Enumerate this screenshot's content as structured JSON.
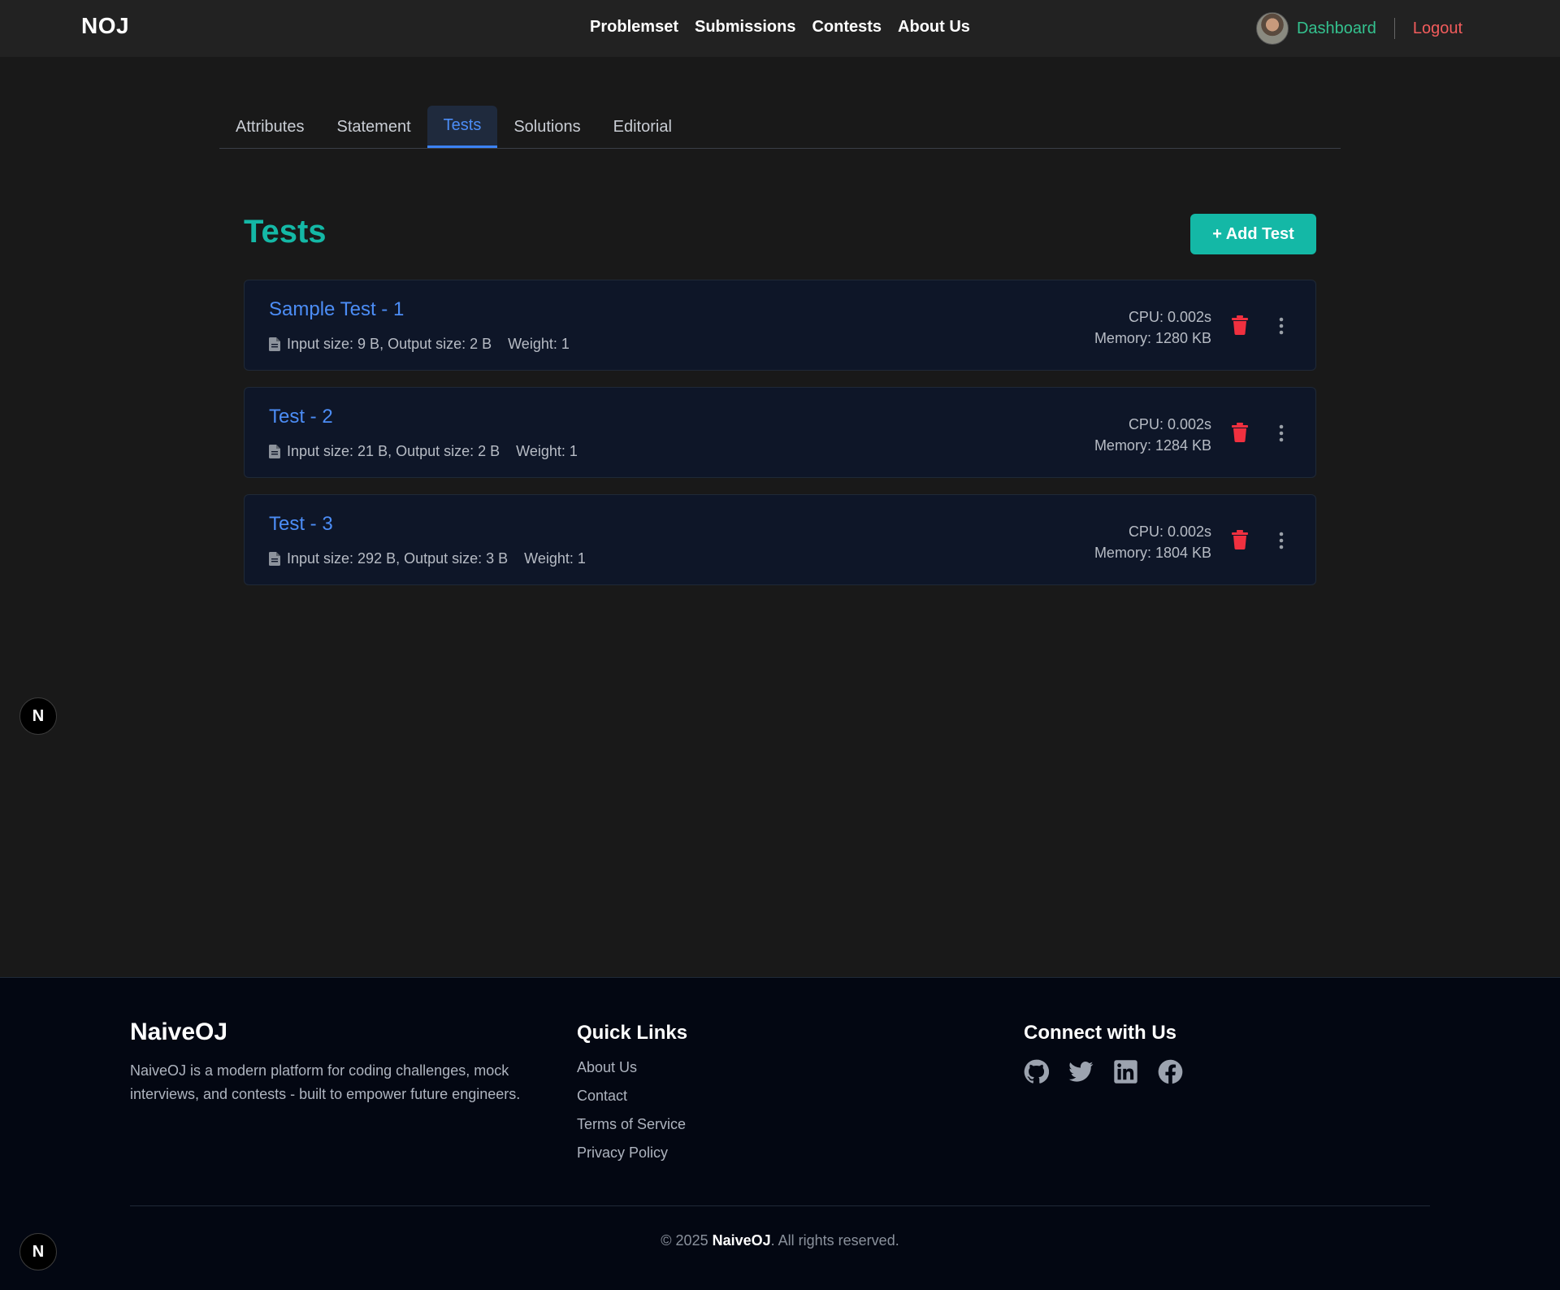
{
  "navbar": {
    "brand": "NOJ",
    "links": [
      "Problemset",
      "Submissions",
      "Contests",
      "About Us"
    ],
    "dashboard": "Dashboard",
    "logout": "Logout"
  },
  "tabs": [
    "Attributes",
    "Statement",
    "Tests",
    "Solutions",
    "Editorial"
  ],
  "active_tab": "Tests",
  "page": {
    "title": "Tests",
    "add_button": "+ Add Test"
  },
  "tests": [
    {
      "name": "Sample Test - 1",
      "io": "Input size: 9 B, Output size: 2 B",
      "weight": "Weight: 1",
      "cpu": "CPU: 0.002s",
      "memory": "Memory: 1280 KB"
    },
    {
      "name": "Test - 2",
      "io": "Input size: 21 B, Output size: 2 B",
      "weight": "Weight: 1",
      "cpu": "CPU: 0.002s",
      "memory": "Memory: 1284 KB"
    },
    {
      "name": "Test - 3",
      "io": "Input size: 292 B, Output size: 3 B",
      "weight": "Weight: 1",
      "cpu": "CPU: 0.002s",
      "memory": "Memory: 1804 KB"
    }
  ],
  "badge": "N",
  "footer": {
    "brand": "NaiveOJ",
    "description": "NaiveOJ is a modern platform for coding challenges, mock interviews, and contests - built to empower future engineers.",
    "quick_links_heading": "Quick Links",
    "quick_links": [
      "About Us",
      "Contact",
      "Terms of Service",
      "Privacy Policy"
    ],
    "connect_heading": "Connect with Us",
    "social_icons": [
      "github-icon",
      "twitter-icon",
      "linkedin-icon",
      "facebook-icon"
    ],
    "copyright_prefix": "© 2025 ",
    "copyright_brand": "NaiveOJ",
    "copyright_suffix": ". All rights reserved."
  },
  "colors": {
    "accent_teal": "#14b8a6",
    "link_blue": "#4c8df6",
    "danger_red": "#f25c5c",
    "dashboard_green": "#34c28f"
  }
}
